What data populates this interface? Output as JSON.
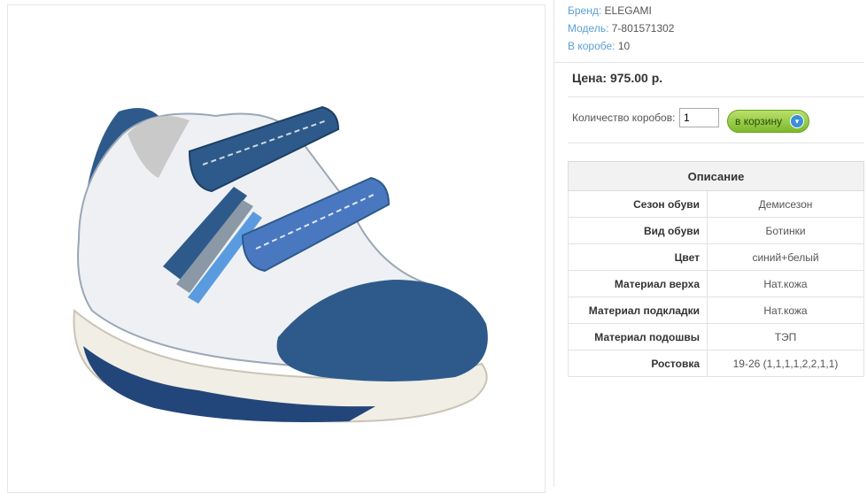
{
  "product": {
    "image_alt": "product-photo",
    "brand_label": "Бренд:",
    "brand_value": "ELEGAMI",
    "model_label": "Модель:",
    "model_value": "7-801571302",
    "box_label": "В коробе:",
    "box_value": "10"
  },
  "price": {
    "text": "Цена: 975.00 р."
  },
  "order": {
    "qty_label": "Количество коробов:",
    "qty_value": "1",
    "cart_label": "в корзину"
  },
  "description": {
    "title": "Описание",
    "rows": [
      {
        "name": "Сезон обуви",
        "value": "Демисезон"
      },
      {
        "name": "Вид обуви",
        "value": "Ботинки"
      },
      {
        "name": "Цвет",
        "value": "синий+белый"
      },
      {
        "name": "Материал верха",
        "value": "Нат.кожа"
      },
      {
        "name": "Материал подкладки",
        "value": "Нат.кожа"
      },
      {
        "name": "Материал подошвы",
        "value": "ТЭП"
      },
      {
        "name": "Ростовка",
        "value": "19-26 (1,1,1,1,2,2,1,1)"
      }
    ]
  },
  "colors": {
    "label_blue": "#5a9fd4",
    "shoe_navy": "#2d5a8a",
    "shoe_blue": "#4a78c0",
    "button_green": "#8cc63f"
  }
}
